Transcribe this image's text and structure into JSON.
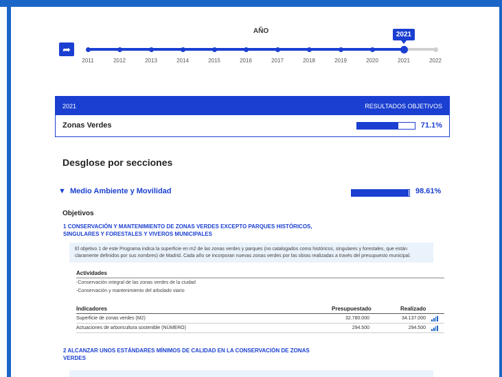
{
  "timeline": {
    "title": "AÑO",
    "years": [
      "2011",
      "2012",
      "2013",
      "2014",
      "2015",
      "2016",
      "2017",
      "2018",
      "2019",
      "2020",
      "2021",
      "2022"
    ],
    "selected_year": "2021",
    "share_icon": "share-arrow-icon"
  },
  "summary": {
    "year": "2021",
    "header_right": "RESULTADOS OBJETIVOS",
    "label": "Zonas Verdes",
    "percent_text": "71.1%",
    "percent_value": 71.1
  },
  "breakdown": {
    "title": "Desglose por secciones",
    "area": {
      "name": "Medio Ambiente y Movilidad",
      "percent_text": "98.61%",
      "percent_value": 98.61
    }
  },
  "objectives": {
    "title": "Objetivos",
    "items": [
      {
        "number": "1",
        "title": "CONSERVACIÓN Y MANTENIMIENTO DE ZONAS VERDES EXCEPTO PARQUES HISTÓRICOS, SINGULARES Y FORESTALES Y VIVEROS MUNICIPALES",
        "description": "El objetivo 1 de este Programa indica la superficie en m2 de las zonas verdes y parques (no catalogados como históricos, singulares y forestales, que están claramente definidos por sus nombres) de Madrid. Cada año se incorporan nuevas zonas verdes por las obras realizadas a través del presupuesto municipal.",
        "activities_title": "Actividades",
        "activities": [
          "-Conservación integral de las zonas verdes de la ciudad",
          "-Conservación y mantenimiento del arbolado viario"
        ],
        "indicators_header": {
          "name": "Indicadores",
          "budgeted": "Presupuestado",
          "achieved": "Realizado"
        },
        "indicators": [
          {
            "name": "Superficie de zonas verdes (M2)",
            "budgeted": "32.780.000",
            "achieved": "34.137.000"
          },
          {
            "name": "Actuaciones de arboricultura sostenible (NÚMERO)",
            "budgeted": "294.500",
            "achieved": "294.500"
          }
        ]
      },
      {
        "number": "2",
        "title": "ALCANZAR UNOS ESTÁNDARES MÍNIMOS DE CALIDAD EN LA CONSERVACIÓN DE ZONAS VERDES"
      }
    ]
  },
  "colors": {
    "brand_blue": "#1a3fd1",
    "frame_blue": "#1a66c7",
    "light_blue": "#eaf2fb"
  }
}
